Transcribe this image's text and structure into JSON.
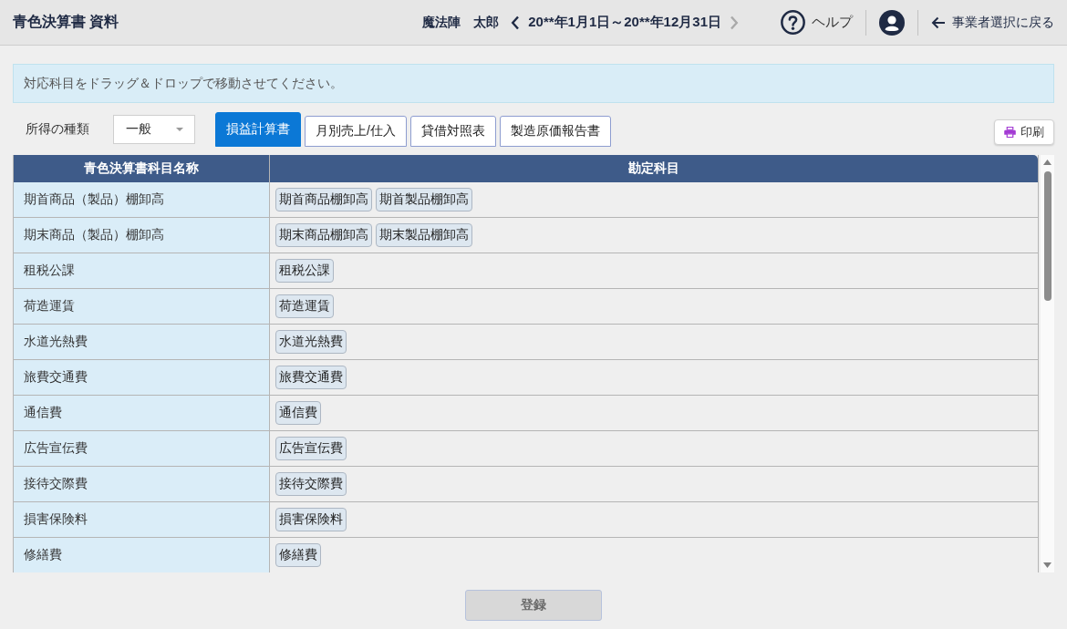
{
  "header": {
    "title": "青色決算書 資料",
    "user_name": "魔法陣　太郎",
    "period": {
      "text": "20**年1月1日～20**年12月31日",
      "prev_disabled": false,
      "next_disabled": true
    },
    "help_label": "ヘルプ",
    "back_label": "事業者選択に戻る"
  },
  "notice": "対応科目をドラッグ＆ドロップで移動させてください。",
  "income_type": {
    "label": "所得の種類",
    "value": "一般"
  },
  "tabs": [
    {
      "label": "損益計算書",
      "selected": true
    },
    {
      "label": "月別売上/仕入",
      "selected": false
    },
    {
      "label": "貸借対照表",
      "selected": false
    },
    {
      "label": "製造原価報告書",
      "selected": false
    }
  ],
  "print_button": "印刷",
  "table": {
    "columns": [
      "青色決算書科目名称",
      "勘定科目"
    ],
    "rows": [
      {
        "name": "期首商品（製品）棚卸高",
        "accounts": [
          "期首商品棚卸高",
          "期首製品棚卸高"
        ]
      },
      {
        "name": "期末商品（製品）棚卸高",
        "accounts": [
          "期末商品棚卸高",
          "期末製品棚卸高"
        ]
      },
      {
        "name": "租税公課",
        "accounts": [
          "租税公課"
        ]
      },
      {
        "name": "荷造運賃",
        "accounts": [
          "荷造運賃"
        ]
      },
      {
        "name": "水道光熱費",
        "accounts": [
          "水道光熱費"
        ]
      },
      {
        "name": "旅費交通費",
        "accounts": [
          "旅費交通費"
        ]
      },
      {
        "name": "通信費",
        "accounts": [
          "通信費"
        ]
      },
      {
        "name": "広告宣伝費",
        "accounts": [
          "広告宣伝費"
        ]
      },
      {
        "name": "接待交際費",
        "accounts": [
          "接待交際費"
        ]
      },
      {
        "name": "損害保険料",
        "accounts": [
          "損害保険料"
        ]
      },
      {
        "name": "修繕費",
        "accounts": [
          "修繕費"
        ]
      }
    ]
  },
  "submit_button": {
    "label": "登録",
    "disabled": true
  }
}
